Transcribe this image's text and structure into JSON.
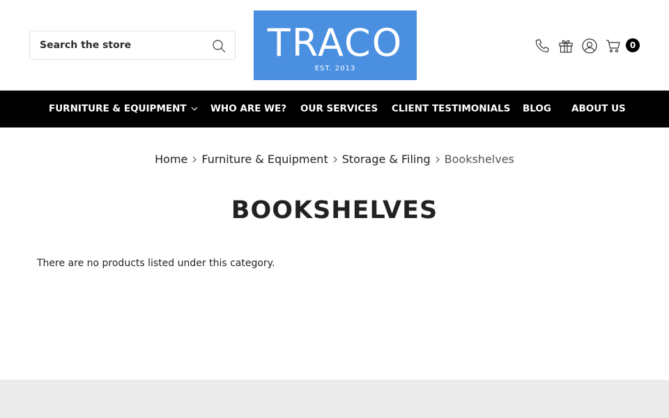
{
  "header": {
    "search": {
      "placeholder": "Search the store"
    },
    "logo": {
      "name": "TRACO",
      "tagline": "EST. 2013",
      "bg_color": "#4a8fe0"
    },
    "icons": [
      "phone-icon",
      "gift-icon",
      "account-icon",
      "cart-icon"
    ],
    "cart_count": "0"
  },
  "nav": {
    "items": [
      {
        "label": "FURNITURE & EQUIPMENT",
        "has_dropdown": true
      },
      {
        "label": "WHO ARE WE?"
      },
      {
        "label": "OUR SERVICES"
      },
      {
        "label": "CLIENT TESTIMONIALS"
      },
      {
        "label": "BLOG"
      },
      {
        "label": "ABOUT US"
      }
    ]
  },
  "breadcrumb": [
    "Home",
    "Furniture & Equipment",
    "Storage & Filing",
    "Bookshelves"
  ],
  "main": {
    "title": "BOOKSHELVES",
    "empty_message": "There are no products listed under this category."
  },
  "colors": {
    "nav_bg": "#000000",
    "footer_bg": "#ebebeb",
    "text": "#222222"
  }
}
